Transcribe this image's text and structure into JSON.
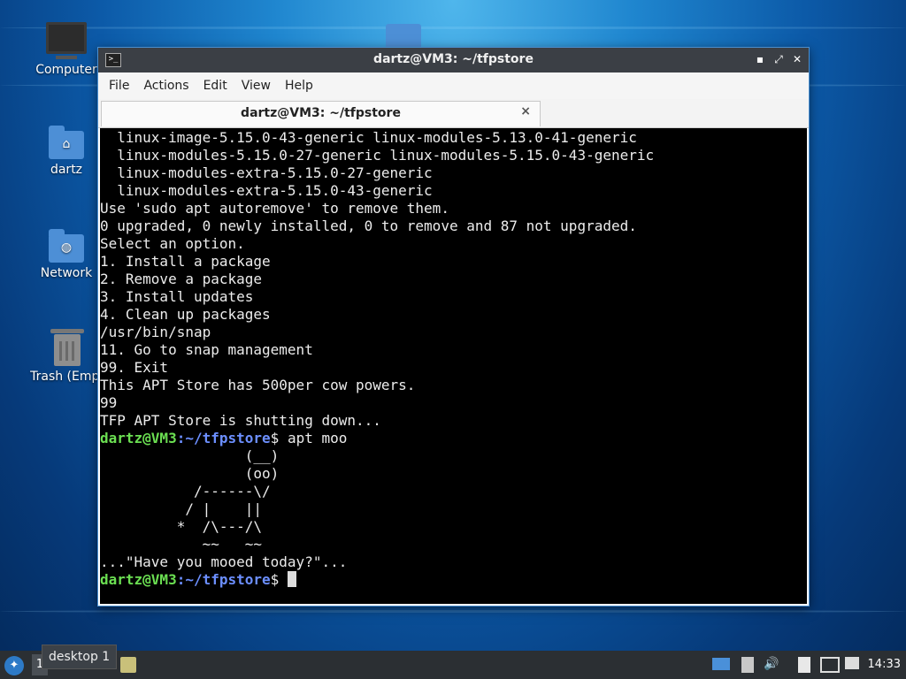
{
  "desktop": {
    "icons": [
      {
        "label": "Computer"
      },
      {
        "label": "dartz"
      },
      {
        "label": "Network"
      },
      {
        "label": "Trash (Empt"
      }
    ]
  },
  "window": {
    "title": "dartz@VM3: ~/tfpstore",
    "menu": [
      "File",
      "Actions",
      "Edit",
      "View",
      "Help"
    ],
    "tab_title": "dartz@VM3: ~/tfpstore",
    "tab_close": "×",
    "buttons": {
      "minimize": "▪",
      "maximize": "⤢",
      "close": "✕"
    }
  },
  "terminal": {
    "output": [
      "  linux-image-5.15.0-43-generic linux-modules-5.13.0-41-generic",
      "  linux-modules-5.15.0-27-generic linux-modules-5.15.0-43-generic",
      "  linux-modules-extra-5.15.0-27-generic",
      "  linux-modules-extra-5.15.0-43-generic",
      "Use 'sudo apt autoremove' to remove them.",
      "0 upgraded, 0 newly installed, 0 to remove and 87 not upgraded.",
      "Select an option.",
      "1. Install a package",
      "2. Remove a package",
      "3. Install updates",
      "4. Clean up packages",
      "/usr/bin/snap",
      "11. Go to snap management",
      "99. Exit",
      "This APT Store has 500per cow powers.",
      "99",
      "TFP APT Store is shutting down..."
    ],
    "prompt1": {
      "user": "dartz@VM3",
      "sep": ":",
      "path": "~/tfpstore",
      "tail": "$ apt moo"
    },
    "moo": [
      "                 (__)",
      "                 (oo)",
      "           /------\\/",
      "          / |    ||",
      "         *  /\\---/\\",
      "            ~~   ~~",
      "...\"Have you mooed today?\"..."
    ],
    "prompt2": {
      "user": "dartz@VM3",
      "sep": ":",
      "path": "~/tfpstore",
      "tail": "$ "
    }
  },
  "taskbar": {
    "start_icon": "start-menu-icon",
    "workspace_number": "1",
    "workspace_tooltip": "desktop 1",
    "clock": "14:33"
  }
}
